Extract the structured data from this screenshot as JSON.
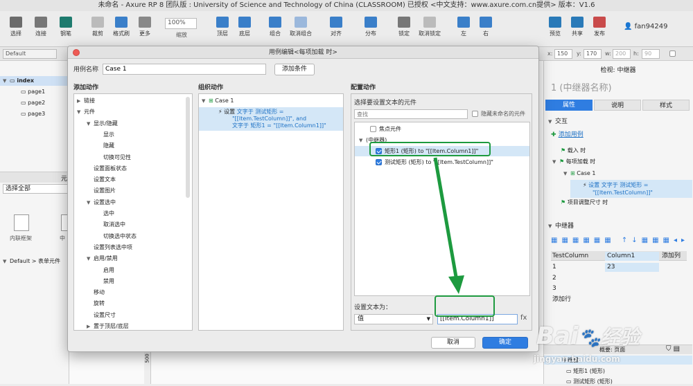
{
  "window_title": "未命名 - Axure RP 8 团队版 : University of Science and Technology of China (CLASSROOM) 已授权   <中文支持：www.axure.com.cn提供> 版本：V1.6",
  "toolbar": {
    "items": [
      "选择",
      "连接",
      "钢笔",
      "裁剪",
      "格式刷",
      "更多",
      "缩放",
      "顶层",
      "底层",
      "组合",
      "取消组合",
      "对齐",
      "分布",
      "锁定",
      "取消锁定",
      "左",
      "右",
      "预览",
      "共享",
      "发布"
    ],
    "zoom": "100%",
    "user": "fan94249"
  },
  "propbar": {
    "style": "Default",
    "x_label": "x:",
    "x": "150",
    "y_label": "y:",
    "y": "170",
    "w_label": "w:",
    "w": "200",
    "h_label": "h:",
    "h": "90"
  },
  "left": {
    "pages": [
      "index",
      "page1",
      "page2",
      "page3"
    ],
    "select_all": "选择全部",
    "yuan": "元",
    "widgets": [
      "内联框架",
      "中"
    ],
    "lib": "Default > 表单元件"
  },
  "dialog": {
    "title": "用例编辑<每项加载 时>",
    "case_name_label": "用例名称",
    "case_name": "Case 1",
    "add_condition": "添加条件",
    "col1_title": "添加动作",
    "col2_title": "组织动作",
    "col3_title": "配置动作",
    "actions": [
      {
        "t": "链接",
        "lvl": 0,
        "tri": "▶"
      },
      {
        "t": "元件",
        "lvl": 0,
        "tri": "▼"
      },
      {
        "t": "显示/隐藏",
        "lvl": 1,
        "tri": "▼"
      },
      {
        "t": "显示",
        "lvl": 2,
        "tri": ""
      },
      {
        "t": "隐藏",
        "lvl": 2,
        "tri": ""
      },
      {
        "t": "切换可见性",
        "lvl": 2,
        "tri": ""
      },
      {
        "t": "设置面板状态",
        "lvl": 1,
        "tri": ""
      },
      {
        "t": "设置文本",
        "lvl": 1,
        "tri": ""
      },
      {
        "t": "设置图片",
        "lvl": 1,
        "tri": ""
      },
      {
        "t": "设置选中",
        "lvl": 1,
        "tri": "▼"
      },
      {
        "t": "选中",
        "lvl": 2,
        "tri": ""
      },
      {
        "t": "取消选中",
        "lvl": 2,
        "tri": ""
      },
      {
        "t": "切换选中状态",
        "lvl": 2,
        "tri": ""
      },
      {
        "t": "设置列表选中项",
        "lvl": 1,
        "tri": ""
      },
      {
        "t": "启用/禁用",
        "lvl": 1,
        "tri": "▼"
      },
      {
        "t": "启用",
        "lvl": 2,
        "tri": ""
      },
      {
        "t": "禁用",
        "lvl": 2,
        "tri": ""
      },
      {
        "t": "移动",
        "lvl": 1,
        "tri": ""
      },
      {
        "t": "旋转",
        "lvl": 1,
        "tri": ""
      },
      {
        "t": "设置尺寸",
        "lvl": 1,
        "tri": ""
      },
      {
        "t": "置于顶层/底层",
        "lvl": 1,
        "tri": "▶"
      }
    ],
    "org_case": "Case 1",
    "org_action_prefix": "设置",
    "org_action_line1": "文字于 测试矩形 =",
    "org_action_line2": "\"[[Item.TestColumn]]\", and",
    "org_action_line3": "文字于 矩形1 = \"[[Item.Column1]]\"",
    "config_sub": "选择要设置文本的元件",
    "search_placeholder": "查找",
    "hide_unnamed": "隐藏未命名的元件",
    "targets": {
      "focus": "焦点元件",
      "repeater": "(中继器)",
      "item1": "矩形1 (矩形) to \"[[Item.Column1]]\"",
      "item2": "测试矩形 (矩形) to \"[[Item.TestColumn]]\""
    },
    "set_text_label": "设置文本为：",
    "value_type": "值",
    "value": "[[Item.Column1]]",
    "fx": "fx",
    "cancel": "取消",
    "ok": "确定"
  },
  "right": {
    "header": "检视: 中继器",
    "name": "(中继器名称)",
    "tabs": [
      "属性",
      "说明",
      "样式"
    ],
    "interaction": "交互",
    "add_case": "添加用例",
    "events": [
      "载入 时",
      "每项加载 时",
      "Case 1",
      "设置 文字于 测试矩形 =",
      "\"[[Item.TestColumn]]\"",
      "项目调整尺寸 时"
    ],
    "repeater_section": "中继器",
    "table_headers": [
      "TestColumn",
      "Column1",
      "添加列"
    ],
    "table_rows": [
      [
        "1",
        "23"
      ],
      [
        "2",
        ""
      ],
      [
        "3",
        ""
      ]
    ],
    "add_row": "添加行",
    "outline_title": "概要: 页面",
    "outline_items": [
      "中继器",
      "矩形1 (矩形)",
      "测试矩形 (矩形)"
    ]
  },
  "canvas": {
    "ruler": "500"
  },
  "watermark": {
    "brand": "Bai",
    "brand2": "经验",
    "url": "jingyan.baidu.com"
  },
  "colors": {
    "accent": "#2f7de1",
    "highlight": "#1d9a3f"
  }
}
